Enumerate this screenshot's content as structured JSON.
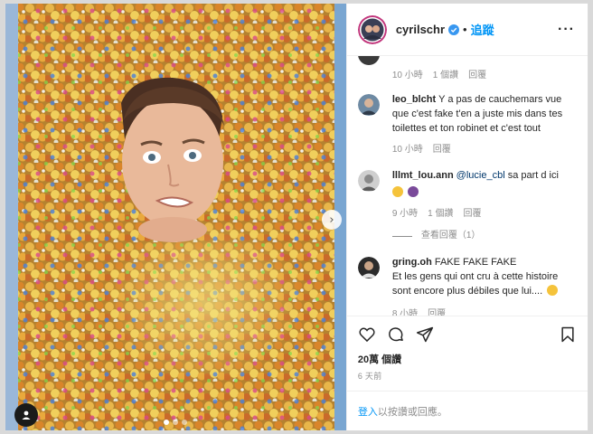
{
  "post": {
    "username": "cyrilschr",
    "follow_label": "追蹤",
    "separator": "•",
    "more_label": "···"
  },
  "comments": [
    {
      "time": "10 小時",
      "likes": "1 個讚",
      "reply": "回覆"
    },
    {
      "user": "leo_blcht",
      "text": "Y a pas de cauchemars vue que c'est fake t'en a juste mis dans tes toilettes et ton robinet et c'est tout",
      "time": "10 小時",
      "reply": "回覆"
    },
    {
      "user": "lllmt_lou.ann",
      "mention": "@lucie_cbl",
      "text": " sa part d ici",
      "time": "9 小時",
      "likes": "1 個讚",
      "reply": "回覆",
      "view_replies": "查看回覆（1）"
    },
    {
      "user": "gring.oh",
      "text": "FAKE FAKE FAKE",
      "text2": "Et les gens qui ont cru à cette histoire sont encore plus débiles que lui....",
      "time": "8 小時",
      "reply": "回覆"
    }
  ],
  "likes_text": "20萬 個讚",
  "posted_ago": "6 天前",
  "login": {
    "link": "登入",
    "text": "以按讚或回應。"
  },
  "icons": [
    "verified-badge-icon",
    "heart-icon",
    "comment-icon",
    "share-icon",
    "bookmark-icon",
    "user-tag-icon",
    "chevron-right-icon"
  ],
  "colors": {
    "accent": "#0095f6",
    "muted": "#8e8e8e",
    "text": "#262626"
  },
  "carousel": {
    "total": 3,
    "active": 1
  }
}
